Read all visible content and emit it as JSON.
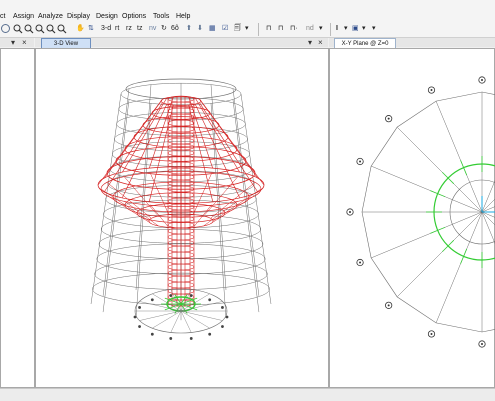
{
  "menu": [
    "ct",
    "Assign",
    "Analyze",
    "Display",
    "Design",
    "Options",
    "Tools",
    "Help"
  ],
  "toolbar": {
    "view_buttons": [
      "3-d",
      "rt",
      "rz",
      "tz",
      "nv"
    ],
    "nd_label": "nd",
    "pan_icon": "hand-icon",
    "zoom_icons": [
      "zoom-in-icon",
      "zoom-out-icon",
      "zoom-window-icon",
      "zoom-previous-icon"
    ]
  },
  "panels": {
    "center_tab": "3-D View",
    "right_tab": "X-Y Plane @ Z=0",
    "close_symbol": "×",
    "pin_symbol": "▾"
  },
  "colors": {
    "frame_gray": "#6e6e6e",
    "frame_red": "#d42020",
    "support_green": "#33cc33",
    "axis_cyan": "#17a9e0"
  }
}
